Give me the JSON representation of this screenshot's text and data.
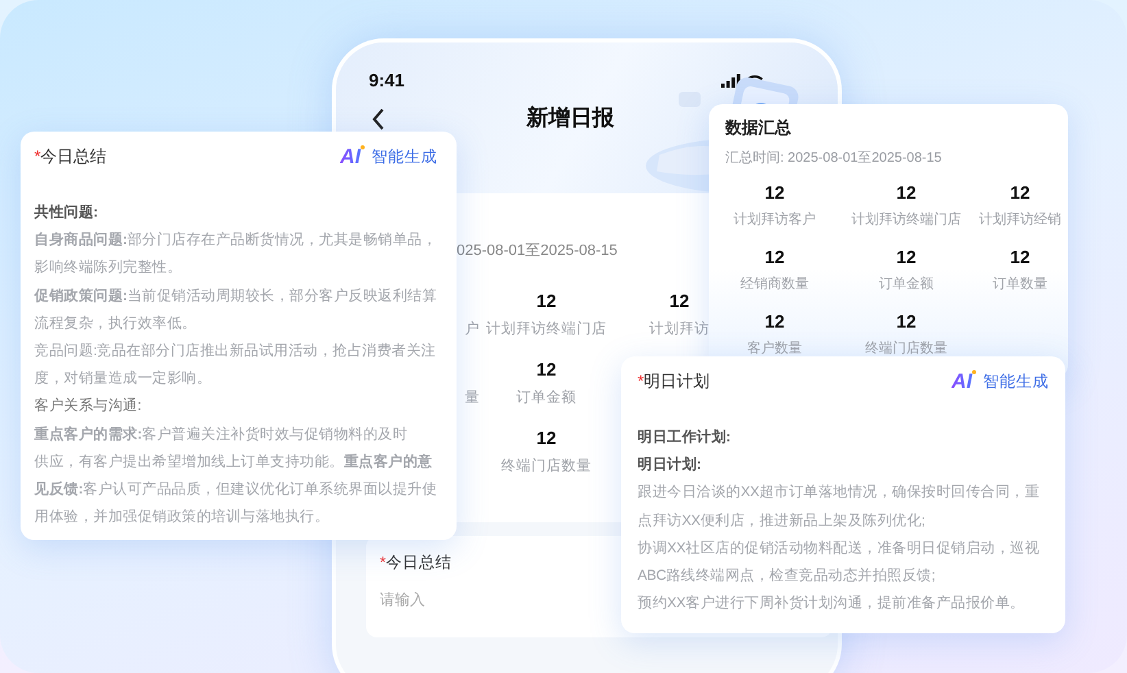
{
  "phone": {
    "status_time": "9:41",
    "title": "新增日报",
    "date_range": "025-08-01至2025-08-15",
    "stat_columns": [
      [
        {
          "label": "户"
        },
        {
          "label": "量"
        }
      ],
      [
        {
          "value": "12",
          "label": "计划拜访终端门店"
        },
        {
          "value": "12",
          "label": "订单金额"
        },
        {
          "value": "12",
          "label": "终端门店数量"
        }
      ],
      [
        {
          "value": "12",
          "label": "计划拜访"
        }
      ]
    ],
    "summary_field": {
      "required_mark": "*",
      "title": "今日总结",
      "placeholder": "请输入"
    }
  },
  "today_summary": {
    "required_mark": "*",
    "title": "今日总结",
    "ai_badge": "AI",
    "ai_action": "智能生成",
    "paragraphs": [
      {
        "kind": "heading",
        "text": "共性问题:"
      },
      {
        "kind": "text",
        "text": "**自身商品问题:**部分门店存在产品断货情况，尤其是畅销单品，影响终端陈列完整性。"
      },
      {
        "kind": "text",
        "text": "**促销政策问题:**当前促销活动周期较长，部分客户反映返利结算流程复杂，执行效率低。"
      },
      {
        "kind": "text",
        "text": "竞品问题:竞品在部分门店推出新品试用活动，抢占消费者关注度，对销量造成一定影响。"
      },
      {
        "kind": "label",
        "text": "客户关系与沟通:"
      },
      {
        "kind": "text",
        "text": "**重点客户的需求:**客户普遍关注补货时效与促销物料的及时"
      },
      {
        "kind": "text",
        "text": "供应，有客户提出希望增加线上订单支持功能。**重点客户的意见反馈:**客户认可产品品质，但建议优化订单系统界面以提升使用体验，并加强促销政策的培训与落地执行。"
      }
    ]
  },
  "data_summary": {
    "title": "数据汇总",
    "period": "汇总时间: 2025-08-01至2025-08-15",
    "stats": [
      {
        "value": "12",
        "label": "计划拜访客户"
      },
      {
        "value": "12",
        "label": "计划拜访终端门店"
      },
      {
        "value": "12",
        "label": "计划拜访经销"
      },
      {
        "value": "12",
        "label": "经销商数量"
      },
      {
        "value": "12",
        "label": "订单金额"
      },
      {
        "value": "12",
        "label": "订单数量"
      },
      {
        "value": "12",
        "label": "客户数量"
      },
      {
        "value": "12",
        "label": "终端门店数量"
      }
    ]
  },
  "tomorrow_plan": {
    "required_mark": "*",
    "title": "明日计划",
    "ai_badge": "AI",
    "ai_action": "智能生成",
    "paragraphs": [
      {
        "kind": "heading",
        "text": "明日工作计划:"
      },
      {
        "kind": "heading",
        "text": "明日计划:"
      },
      {
        "kind": "text",
        "text": "跟进今日洽谈的XX超市订单落地情况，确保按时回传合同，重点拜访XX便利店，推进新品上架及陈列优化;"
      },
      {
        "kind": "text",
        "text": "协调XX社区店的促销活动物料配送，准备明日促销启动，巡视ABC路线终端网点，检查竞品动态并拍照反馈;"
      },
      {
        "kind": "text",
        "text": "预约XX客户进行下周补货计划沟通，提前准备产品报价单。"
      }
    ]
  }
}
